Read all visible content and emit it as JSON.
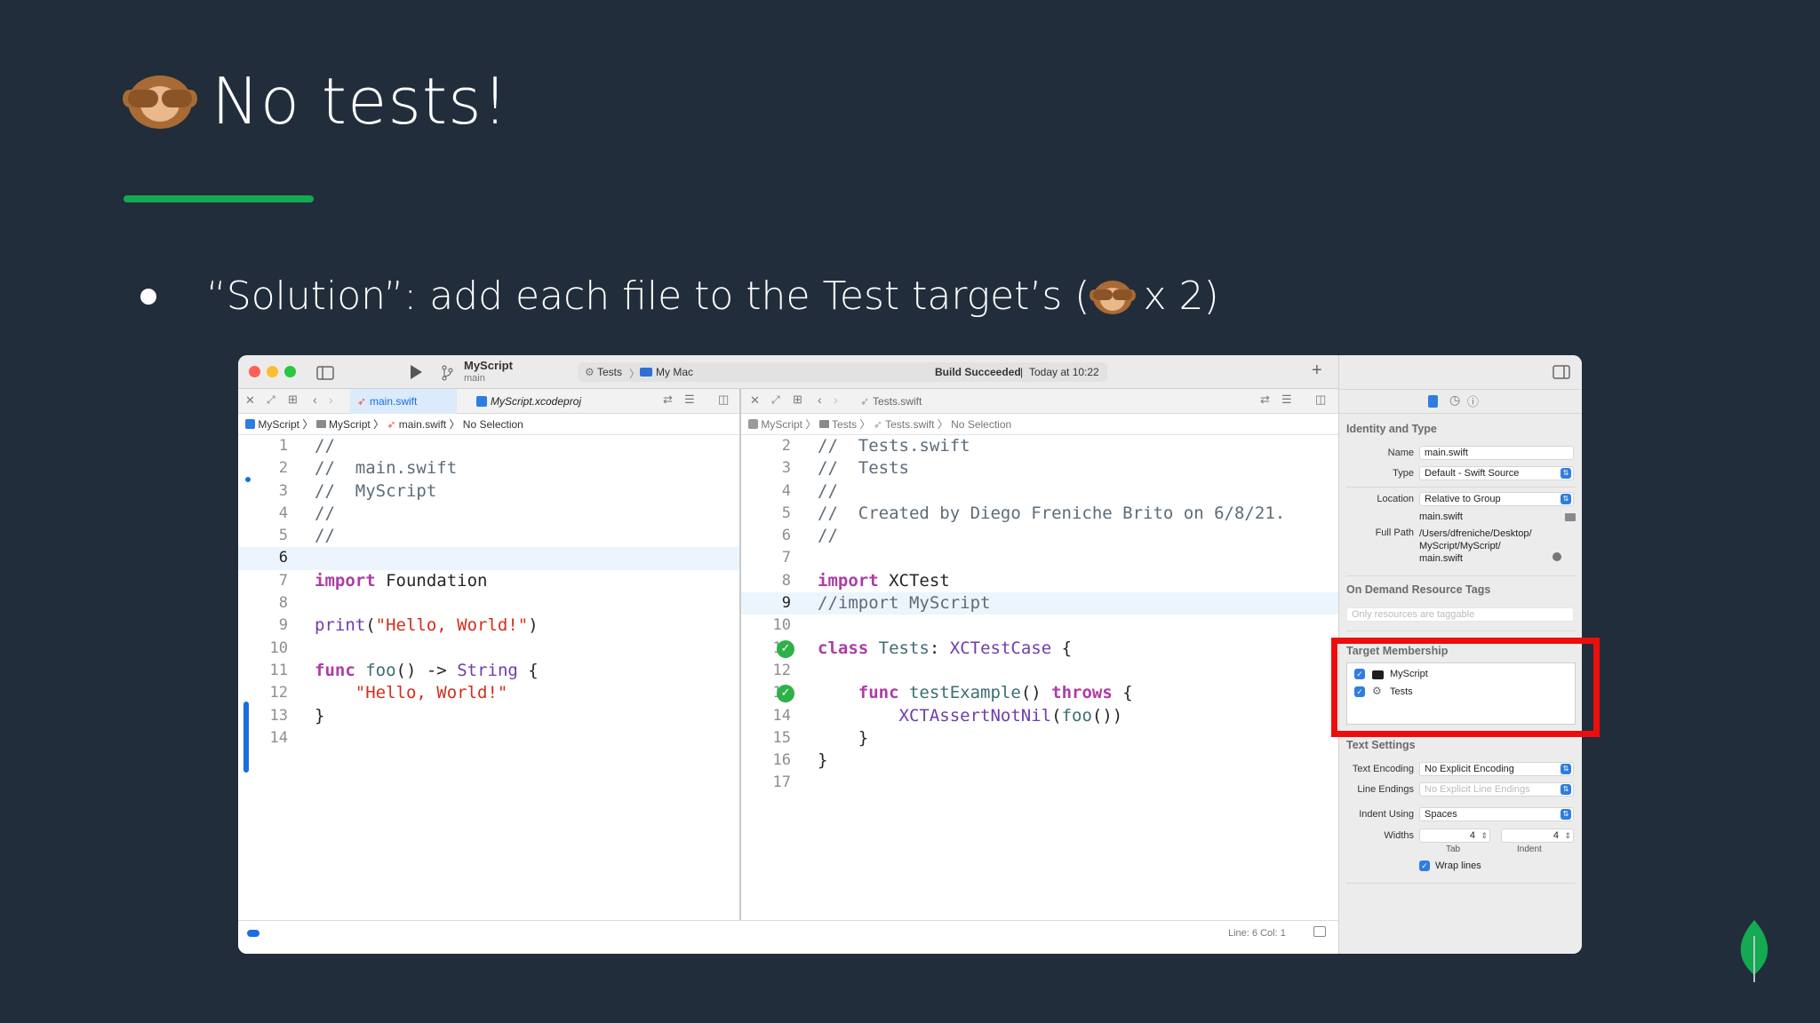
{
  "slide": {
    "title": "No tests!",
    "bullet_text": "“Solution”: add each file to the Test target’s (",
    "bullet_tail": " x 2)"
  },
  "colors": {
    "accent_green": "#13aa52",
    "background": "#212d3a",
    "highlight_red": "#ee0d0d"
  },
  "xcode": {
    "toolbar": {
      "scheme_name": "MyScript",
      "scheme_branch": "main",
      "status_scheme": "Tests",
      "status_destination": "My Mac",
      "status_build": "Build Succeeded",
      "status_time": "Today at 10:22"
    },
    "left_editor": {
      "tabs": [
        "main.swift",
        "MyScript.xcodeproj"
      ],
      "jump": [
        "MyScript",
        "MyScript",
        "main.swift",
        "No Selection"
      ],
      "lines": [
        {
          "n": "1",
          "parts": [
            {
              "c": "cm",
              "t": "//"
            }
          ]
        },
        {
          "n": "2",
          "parts": [
            {
              "c": "cm",
              "t": "//  main.swift"
            }
          ]
        },
        {
          "n": "3",
          "parts": [
            {
              "c": "cm",
              "t": "//  MyScript"
            }
          ]
        },
        {
          "n": "4",
          "parts": [
            {
              "c": "cm",
              "t": "//"
            }
          ]
        },
        {
          "n": "5",
          "parts": [
            {
              "c": "cm",
              "t": "//"
            }
          ]
        },
        {
          "n": "6",
          "hl": true,
          "parts": []
        },
        {
          "n": "7",
          "parts": [
            {
              "c": "kw",
              "t": "import"
            },
            {
              "c": "",
              "t": " Foundation"
            }
          ]
        },
        {
          "n": "8",
          "parts": []
        },
        {
          "n": "9",
          "parts": [
            {
              "c": "ty",
              "t": "print"
            },
            {
              "c": "",
              "t": "("
            },
            {
              "c": "str",
              "t": "\"Hello, World!\""
            },
            {
              "c": "",
              "t": ")"
            }
          ]
        },
        {
          "n": "10",
          "parts": []
        },
        {
          "n": "11",
          "parts": [
            {
              "c": "kw",
              "t": "func"
            },
            {
              "c": "",
              "t": " "
            },
            {
              "c": "fn",
              "t": "foo"
            },
            {
              "c": "",
              "t": "() -> "
            },
            {
              "c": "ty",
              "t": "String"
            },
            {
              "c": "",
              "t": " {"
            }
          ]
        },
        {
          "n": "12",
          "parts": [
            {
              "c": "",
              "t": "    "
            },
            {
              "c": "str",
              "t": "\"Hello, World!\""
            }
          ]
        },
        {
          "n": "13",
          "parts": [
            {
              "c": "",
              "t": "}"
            }
          ]
        },
        {
          "n": "14",
          "parts": []
        }
      ]
    },
    "right_editor": {
      "tabs": [
        "Tests.swift"
      ],
      "jump": [
        "MyScript",
        "Tests",
        "Tests.swift",
        "No Selection"
      ],
      "lines": [
        {
          "n": "2",
          "parts": [
            {
              "c": "cm",
              "t": "//  Tests.swift"
            }
          ]
        },
        {
          "n": "3",
          "parts": [
            {
              "c": "cm",
              "t": "//  Tests"
            }
          ]
        },
        {
          "n": "4",
          "parts": [
            {
              "c": "cm",
              "t": "//"
            }
          ]
        },
        {
          "n": "5",
          "parts": [
            {
              "c": "cm",
              "t": "//  Created by Diego Freniche Brito on 6/8/21."
            }
          ]
        },
        {
          "n": "6",
          "parts": [
            {
              "c": "cm",
              "t": "//"
            }
          ]
        },
        {
          "n": "7",
          "parts": []
        },
        {
          "n": "8",
          "parts": [
            {
              "c": "kw",
              "t": "import"
            },
            {
              "c": "",
              "t": " XCTest"
            }
          ]
        },
        {
          "n": "9",
          "hl": true,
          "parts": [
            {
              "c": "cm",
              "t": "//import MyScript"
            }
          ]
        },
        {
          "n": "10",
          "parts": []
        },
        {
          "n": "11",
          "check": true,
          "parts": [
            {
              "c": "kw",
              "t": "class"
            },
            {
              "c": "",
              "t": " "
            },
            {
              "c": "fn",
              "t": "Tests"
            },
            {
              "c": "",
              "t": ": "
            },
            {
              "c": "ty",
              "t": "XCTestCase"
            },
            {
              "c": "",
              "t": " {"
            }
          ]
        },
        {
          "n": "12",
          "parts": []
        },
        {
          "n": "13",
          "check": true,
          "parts": [
            {
              "c": "",
              "t": "    "
            },
            {
              "c": "kw",
              "t": "func"
            },
            {
              "c": "",
              "t": " "
            },
            {
              "c": "fn",
              "t": "testExample"
            },
            {
              "c": "",
              "t": "() "
            },
            {
              "c": "kw",
              "t": "throws"
            },
            {
              "c": "",
              "t": " {"
            }
          ]
        },
        {
          "n": "14",
          "parts": [
            {
              "c": "",
              "t": "        "
            },
            {
              "c": "ty",
              "t": "XCTAssertNotNil"
            },
            {
              "c": "",
              "t": "("
            },
            {
              "c": "fn",
              "t": "foo"
            },
            {
              "c": "",
              "t": "())"
            }
          ]
        },
        {
          "n": "15",
          "parts": [
            {
              "c": "",
              "t": "    }"
            }
          ]
        },
        {
          "n": "16",
          "parts": [
            {
              "c": "",
              "t": "}"
            }
          ]
        },
        {
          "n": "17",
          "parts": []
        }
      ],
      "cursor_status": "Line: 6  Col: 1"
    },
    "inspector": {
      "identity_header": "Identity and Type",
      "name_label": "Name",
      "name_value": "main.swift",
      "type_label": "Type",
      "type_value": "Default - Swift Source",
      "location_label": "Location",
      "location_value": "Relative to Group",
      "location_file": "main.swift",
      "fullpath_label": "Full Path",
      "fullpath_1": "/Users/dfreniche/Desktop/",
      "fullpath_2": "MyScript/MyScript/",
      "fullpath_3": "main.swift",
      "odr_header": "On Demand Resource Tags",
      "odr_placeholder": "Only resources are taggable",
      "target_header": "Target Membership",
      "targets": [
        "MyScript",
        "Tests"
      ],
      "text_header": "Text Settings",
      "encoding_label": "Text Encoding",
      "encoding_value": "No Explicit Encoding",
      "endings_label": "Line Endings",
      "endings_value": "No Explicit Line Endings",
      "indent_label": "Indent Using",
      "indent_value": "Spaces",
      "widths_label": "Widths",
      "tab_width": "4",
      "indent_width": "4",
      "tab_caption": "Tab",
      "indent_caption": "Indent",
      "wrap_label": "Wrap lines"
    }
  }
}
